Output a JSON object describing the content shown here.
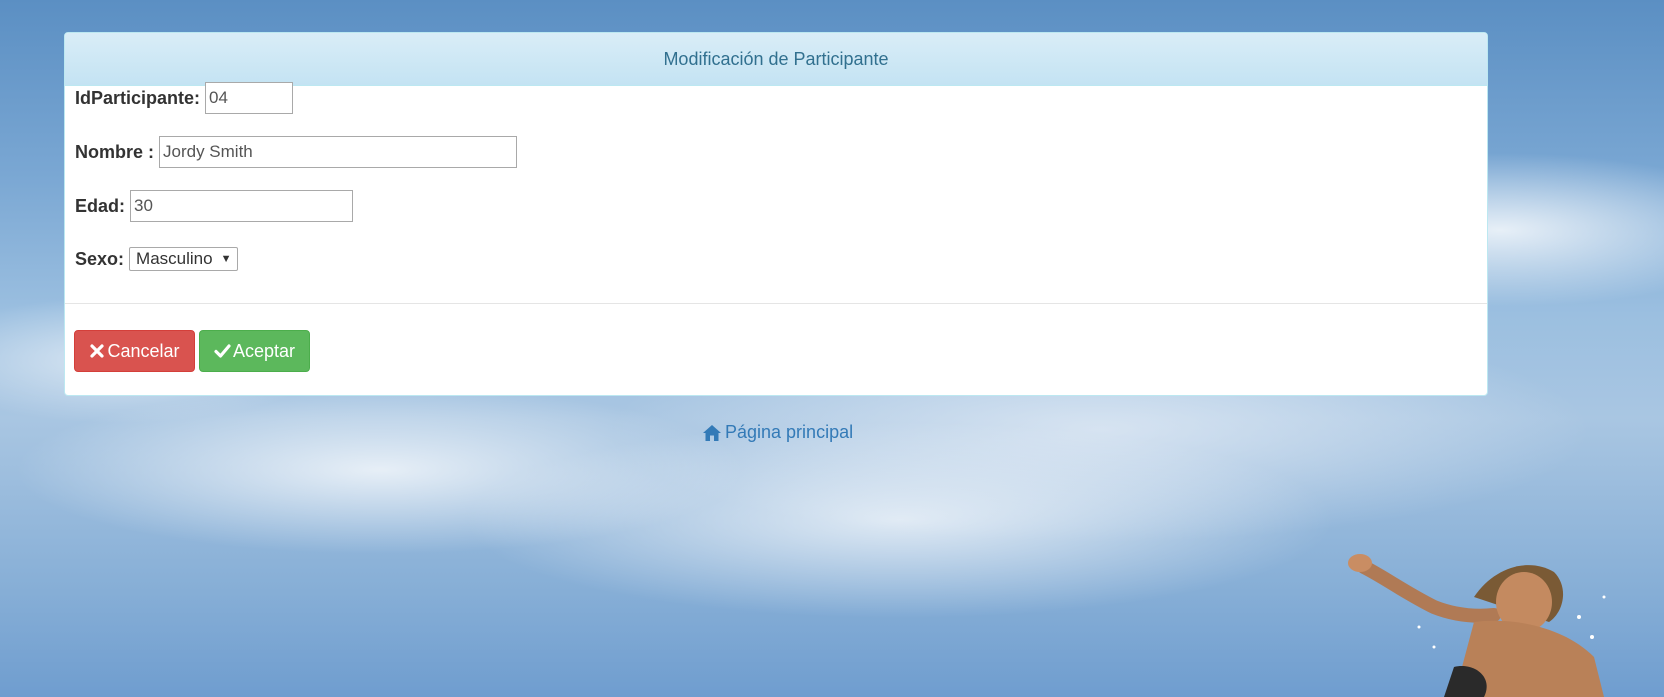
{
  "panel": {
    "title": "Modificación de Participante"
  },
  "form": {
    "id_label": "IdParticipante:",
    "id_value": "04",
    "name_label": "Nombre :",
    "name_value": "Jordy Smith",
    "age_label": "Edad:",
    "age_value": "30",
    "sex_label": "Sexo:",
    "sex_selected": "Masculino"
  },
  "buttons": {
    "cancel_label": "Cancelar",
    "cancel_icon": "times-icon",
    "accept_label": "Aceptar",
    "accept_icon": "check-icon",
    "cancel_color": "#d9534f",
    "accept_color": "#5cb85c"
  },
  "footer": {
    "home_label": "Página principal",
    "home_icon": "home-icon",
    "link_color": "#337ab7"
  }
}
